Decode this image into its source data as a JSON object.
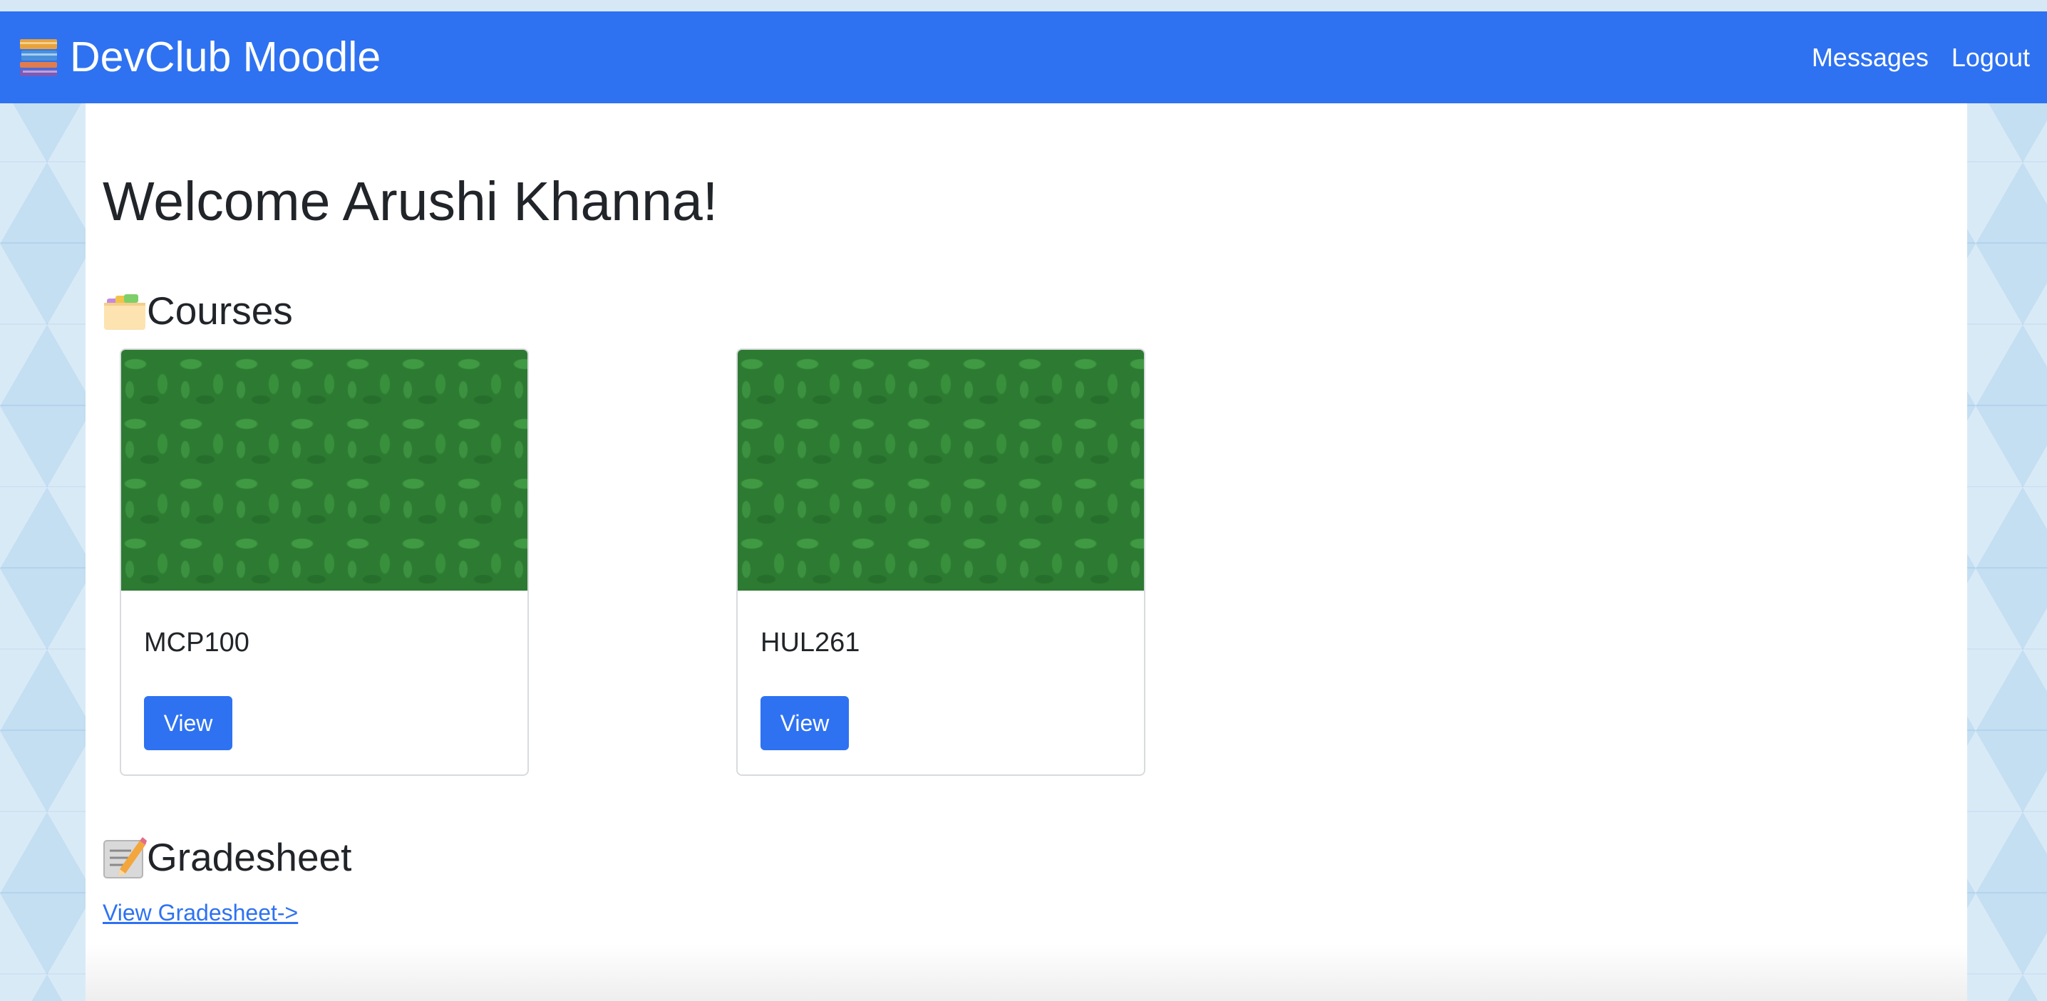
{
  "navbar": {
    "brand": "DevClub Moodle",
    "brand_icon": "books-icon",
    "links": [
      "Messages",
      "Logout"
    ],
    "bg_color": "#2e72f2"
  },
  "main": {
    "welcome": "Welcome Arushi Khanna!",
    "courses": {
      "title": "Courses",
      "icon": "card-index-dividers-icon",
      "items": [
        {
          "name": "MCP100",
          "button": "View"
        },
        {
          "name": "HUL261",
          "button": "View"
        }
      ]
    },
    "gradesheet": {
      "title": "Gradesheet",
      "icon": "memo-icon",
      "link": "View Gradesheet->"
    }
  },
  "colors": {
    "accent": "#2e72f2",
    "text": "#212529",
    "card_image": "#2d7a32"
  }
}
